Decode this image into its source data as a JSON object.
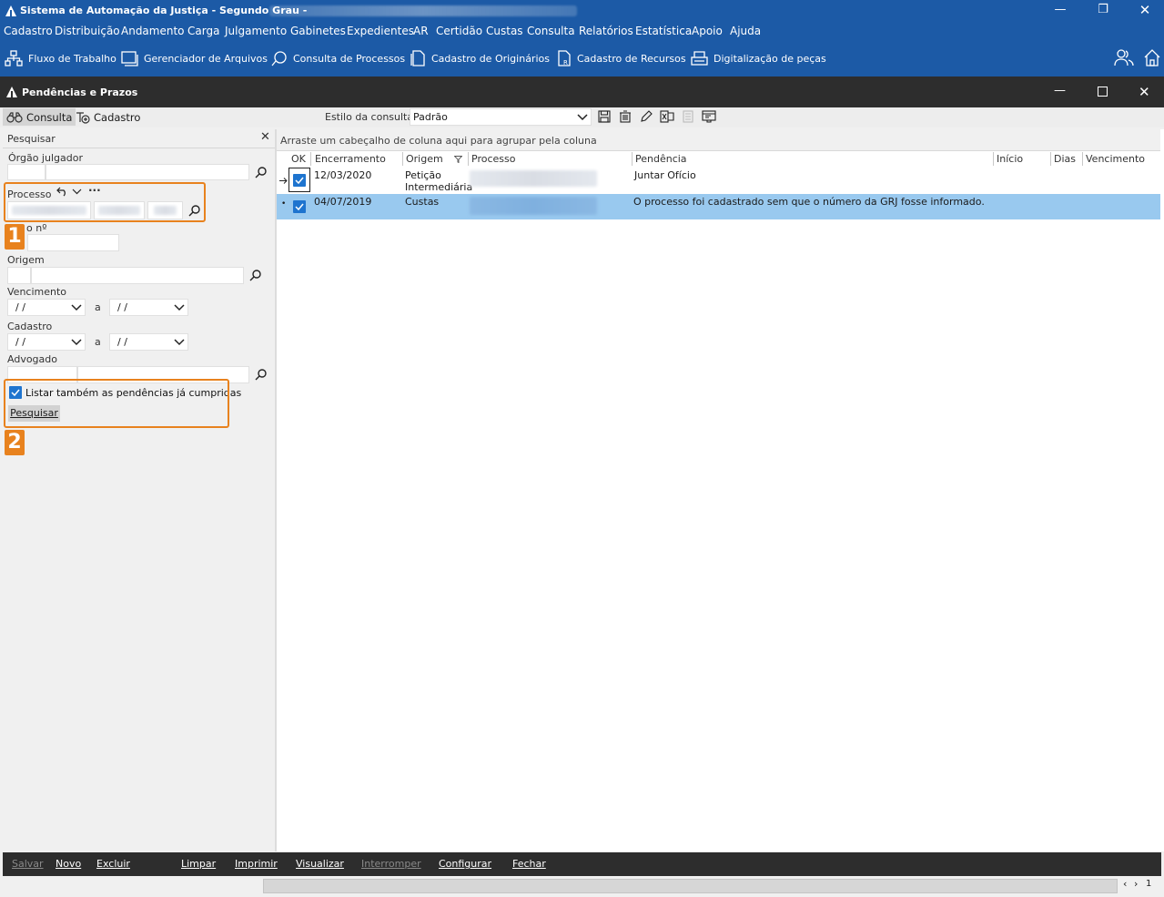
{
  "window": {
    "title": "Sistema de Automação da Justiça - Segundo Grau -"
  },
  "menu": [
    "Cadastro",
    "Distribuição",
    "Andamento",
    "Carga",
    "Julgamento",
    "Gabinetes",
    "Expedientes",
    "AR",
    "Certidão",
    "Custas",
    "Consulta",
    "Relatórios",
    "Estatística",
    "Apoio",
    "Ajuda"
  ],
  "toolbar": {
    "fluxo": "Fluxo de Trabalho",
    "gerenciador": "Gerenciador de Arquivos",
    "consulta": "Consulta de Processos",
    "originarios": "Cadastro de Originários",
    "recursos": "Cadastro de Recursos",
    "digitalizacao": "Digitalização de peças"
  },
  "inner_window": {
    "title": "Pendências e Prazos"
  },
  "tabs": {
    "consulta": "Consulta",
    "cadastro": "Cadastro"
  },
  "estilo": {
    "label": "Estilo da consulta",
    "value": "Padrão"
  },
  "left_panel": {
    "header": "Pesquisar",
    "orgao_label": "Órgão julgador",
    "processo_label": "Processo",
    "prazo_label": "o nº",
    "origem_label": "Origem",
    "vencimento_label": "Vencimento",
    "cadastro_label": "Cadastro",
    "date_placeholder": "/ /",
    "a_label": "a",
    "advogado_label": "Advogado",
    "checkbox_label": "Listar também as pendências já cumpridas",
    "checkbox_checked": true,
    "search_button": "Pesquisar",
    "badge1": "1",
    "badge2": "2"
  },
  "grid": {
    "group_hint": "Arraste um cabeçalho de coluna aqui para agrupar pela coluna",
    "columns": [
      "OK",
      "Encerramento",
      "Origem",
      "Processo",
      "Pendência",
      "Início",
      "Dias",
      "Vencimento"
    ],
    "rows": [
      {
        "ok": true,
        "encerramento": "12/03/2020",
        "origem_l1": "Petição",
        "origem_l2": "Intermediária",
        "pendencia": "Juntar Ofício"
      },
      {
        "ok": true,
        "encerramento": "04/07/2019",
        "origem_l1": "Custas",
        "origem_l2": "",
        "pendencia": "O processo foi cadastrado sem que o número da GRJ fosse informado."
      }
    ]
  },
  "actions": [
    "Salvar",
    "Novo",
    "Excluir",
    "Limpar",
    "Imprimir",
    "Visualizar",
    "Interromper",
    "Configurar",
    "Fechar"
  ],
  "status": {
    "page": "1"
  },
  "colors": {
    "titlebar": "#1c5aa6",
    "dark": "#2d2d2d",
    "highlight": "#e8821e",
    "selected_row": "#99c9ef",
    "checkbox": "#1e74cf"
  }
}
